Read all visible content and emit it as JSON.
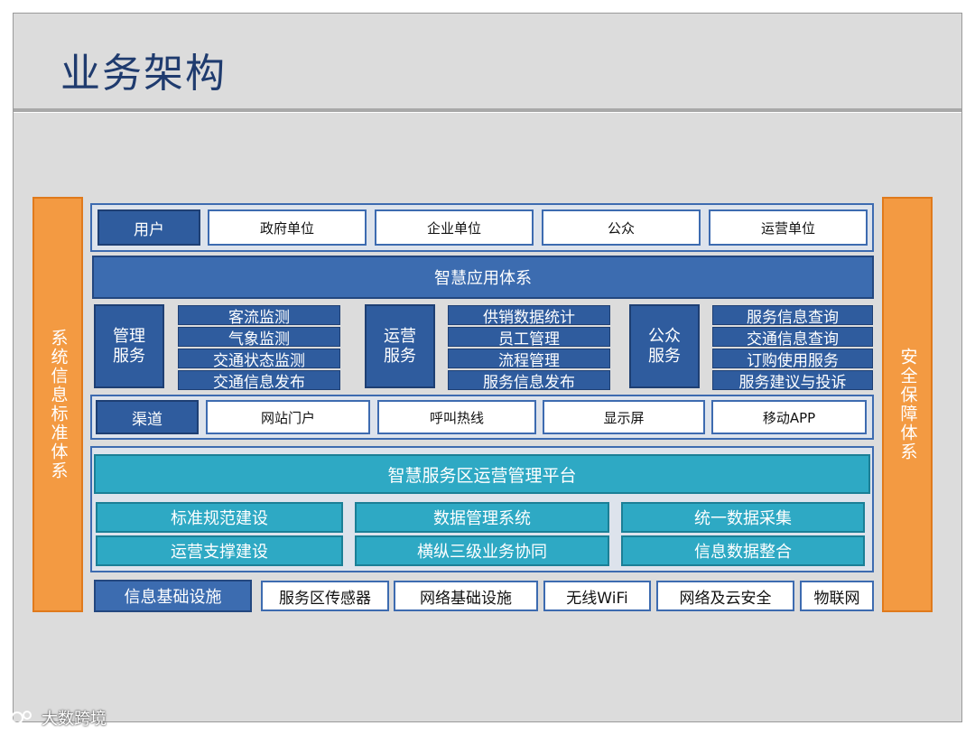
{
  "title": "业务架构",
  "left_side": "系统信息标准体系",
  "right_side": "安全保障体系",
  "users": {
    "label": "用户",
    "items": [
      "政府单位",
      "企业单位",
      "公众",
      "运营单位"
    ]
  },
  "app_system": "智慧应用体系",
  "service_groups": [
    {
      "label": "管理服务",
      "items": [
        "客流监测",
        "气象监测",
        "交通状态监测",
        "交通信息发布"
      ]
    },
    {
      "label": "运营服务",
      "items": [
        "供销数据统计",
        "员工管理",
        "流程管理",
        "服务信息发布"
      ]
    },
    {
      "label": "公众服务",
      "items": [
        "服务信息查询",
        "交通信息查询",
        "订购使用服务",
        "服务建议与投诉"
      ]
    }
  ],
  "channels": {
    "label": "渠道",
    "items": [
      "网站门户",
      "呼叫热线",
      "显示屏",
      "移动APP"
    ]
  },
  "platform": {
    "title": "智慧服务区运营管理平台",
    "items": [
      "标准规范建设",
      "数据管理系统",
      "统一数据采集",
      "运营支撑建设",
      "横纵三级业务协同",
      "信息数据整合"
    ]
  },
  "infrastructure": {
    "label": "信息基础设施",
    "items": [
      "服务区传感器",
      "网络基础设施",
      "无线WiFi",
      "网络及云安全",
      "物联网"
    ]
  },
  "watermark": "大数跨境"
}
